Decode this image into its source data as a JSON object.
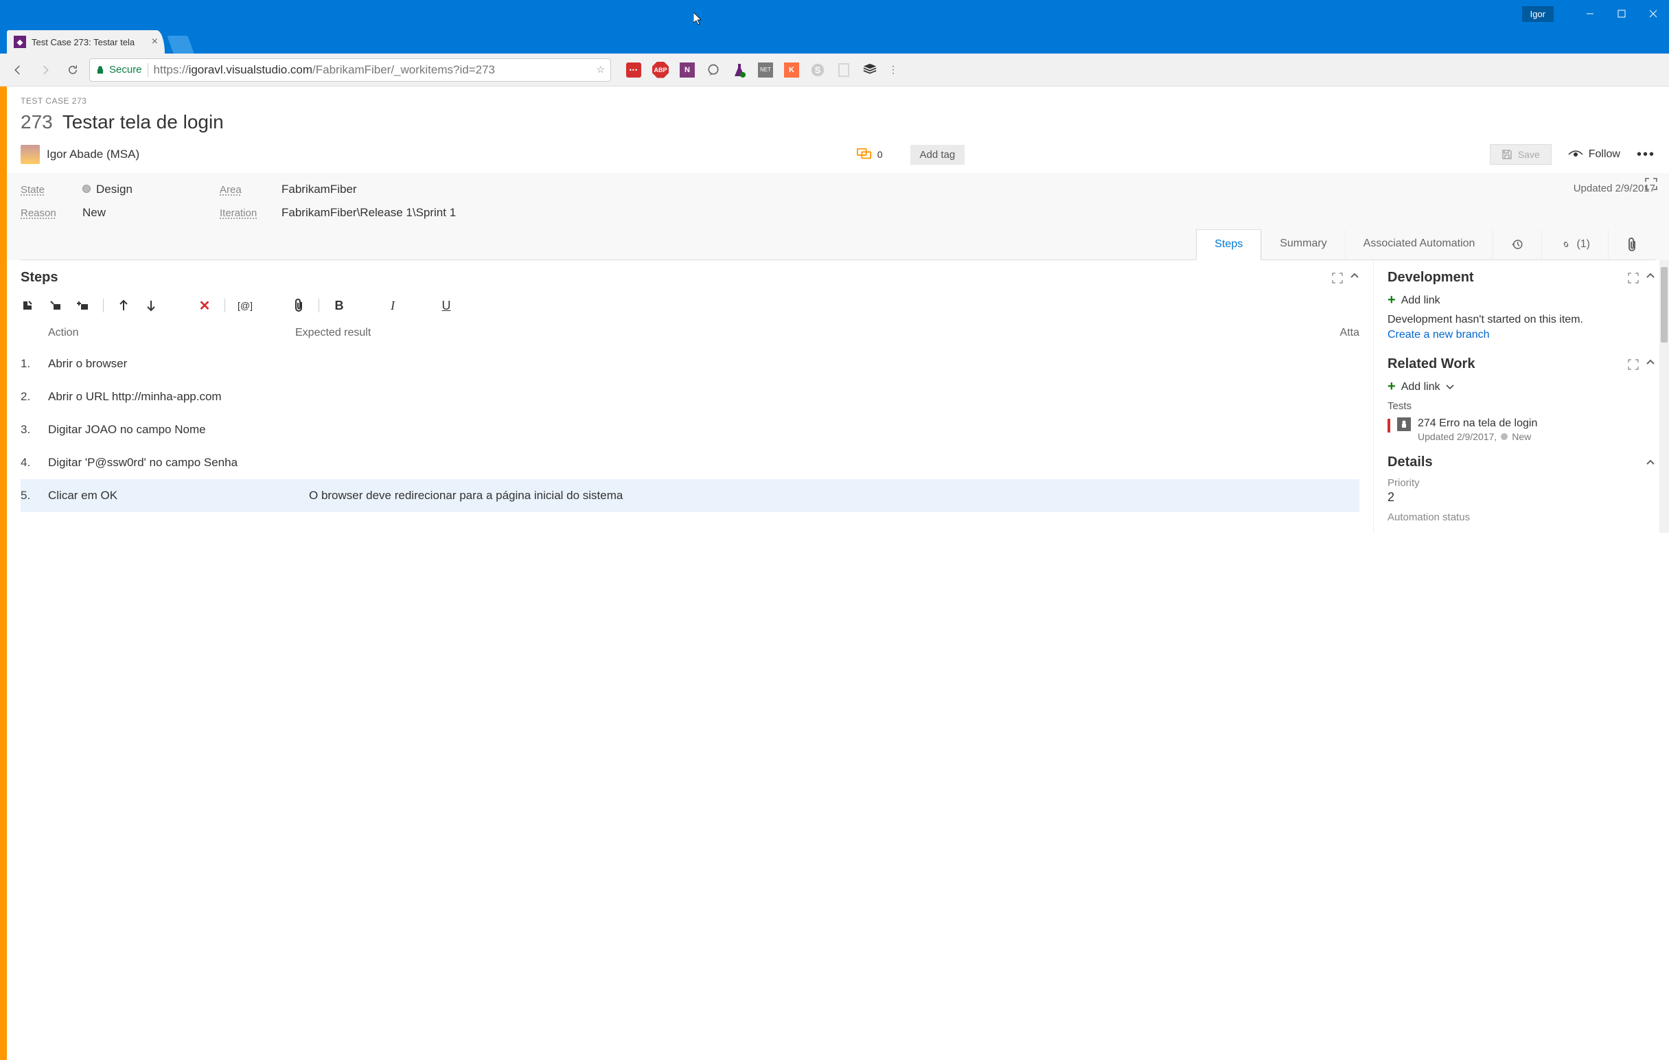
{
  "browser": {
    "user": "Igor",
    "tab_title": "Test Case 273: Testar tela",
    "secure_label": "Secure",
    "url_scheme": "https://",
    "url_host": "igoravl.visualstudio.com",
    "url_path": "/FabrikamFiber/_workitems?id=273"
  },
  "workitem": {
    "type_header": "TEST CASE 273",
    "id": "273",
    "title": "Testar tela de login",
    "assignee": "Igor Abade (MSA)",
    "comment_count": "0",
    "add_tag_label": "Add tag",
    "save_label": "Save",
    "follow_label": "Follow",
    "fields": {
      "state_label": "State",
      "state_value": "Design",
      "reason_label": "Reason",
      "reason_value": "New",
      "area_label": "Area",
      "area_value": "FabrikamFiber",
      "iteration_label": "Iteration",
      "iteration_value": "FabrikamFiber\\Release 1\\Sprint 1",
      "updated": "Updated 2/9/2017"
    },
    "tabs": {
      "steps": "Steps",
      "summary": "Summary",
      "automation": "Associated Automation",
      "links_count": "(1)"
    }
  },
  "steps_section": {
    "title": "Steps",
    "col_action": "Action",
    "col_expected": "Expected result",
    "col_att": "Atta",
    "rows": [
      {
        "n": "1.",
        "action": "Abrir o browser",
        "expected": ""
      },
      {
        "n": "2.",
        "action": "Abrir o URL http://minha-app.com",
        "expected": ""
      },
      {
        "n": "3.",
        "action": "Digitar JOAO no campo Nome",
        "expected": ""
      },
      {
        "n": "4.",
        "action": "Digitar 'P@ssw0rd' no campo Senha",
        "expected": ""
      },
      {
        "n": "5.",
        "action": "Clicar em OK",
        "expected": "O browser deve redirecionar para a página inicial do sistema"
      }
    ]
  },
  "development": {
    "title": "Development",
    "add_link": "Add link",
    "text": "Development hasn't started on this item.",
    "create_branch": "Create a new branch"
  },
  "related": {
    "title": "Related Work",
    "add_link": "Add link",
    "group": "Tests",
    "item_id": "274",
    "item_title": "Erro na tela de login",
    "item_meta": "Updated 2/9/2017,",
    "item_state": "New"
  },
  "details": {
    "title": "Details",
    "priority_label": "Priority",
    "priority_value": "2",
    "automation_label": "Automation status"
  }
}
